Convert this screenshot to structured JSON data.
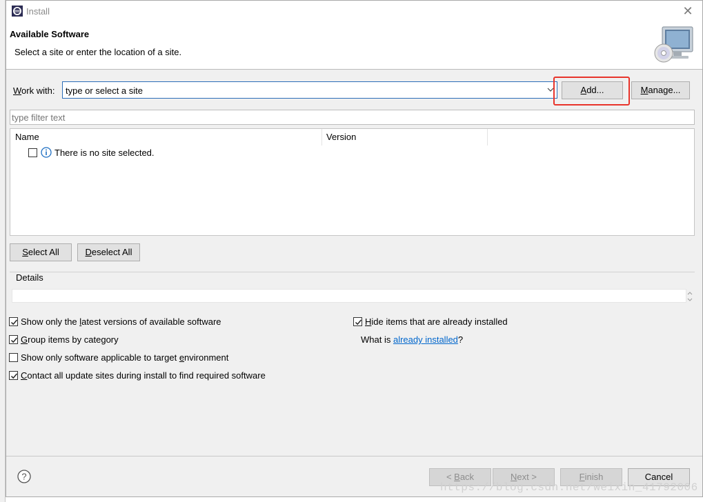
{
  "window": {
    "title": "Install",
    "close_icon": "close-icon"
  },
  "banner": {
    "title": "Available Software",
    "subtitle": "Select a site or enter the location of a site."
  },
  "work_with": {
    "label_underlined": "W",
    "label_rest": "ork with:",
    "combo_value": "type or select a site",
    "add_label_underlined": "A",
    "add_label_rest": "dd...",
    "manage_label_underlined": "M",
    "manage_label_rest": "anage..."
  },
  "filter": {
    "placeholder": "type filter text"
  },
  "table": {
    "columns": [
      "Name",
      "Version"
    ],
    "rows": [
      {
        "checked": false,
        "icon": "info-icon",
        "text": "There is no site selected."
      }
    ]
  },
  "selection_buttons": {
    "select_all_underlined": "S",
    "select_all_rest": "elect All",
    "deselect_all_underlined": "D",
    "deselect_all_rest": "eselect All"
  },
  "details": {
    "label": "Details",
    "value": ""
  },
  "options": {
    "left": [
      {
        "checked": true,
        "pre": "Show only the ",
        "underlined": "l",
        "post": "atest versions of available software"
      },
      {
        "checked": true,
        "pre": "",
        "underlined": "G",
        "post": "roup items by category"
      },
      {
        "checked": false,
        "pre": "Show only software applicable to target ",
        "underlined": "e",
        "post": "nvironment"
      },
      {
        "checked": true,
        "pre": "",
        "underlined": "C",
        "post": "ontact all update sites during install to find required software"
      }
    ],
    "right": {
      "hide_checked": true,
      "hide_underlined": "H",
      "hide_rest": "ide items that are already installed",
      "what_is_pre": "What is ",
      "what_is_link": "already installed",
      "what_is_post": "?"
    }
  },
  "footer": {
    "help_icon": "help-icon",
    "back_pre": "< ",
    "back_underlined": "B",
    "back_rest": "ack",
    "next_underlined": "N",
    "next_rest": "ext >",
    "finish_underlined": "F",
    "finish_rest": "inish",
    "cancel_label": "Cancel"
  },
  "watermark": "https://blog.csdn.net/weixin_41792006",
  "colors": {
    "accent_border": "#2b6cb8",
    "highlight": "#e8332a",
    "link": "#0066cc"
  }
}
